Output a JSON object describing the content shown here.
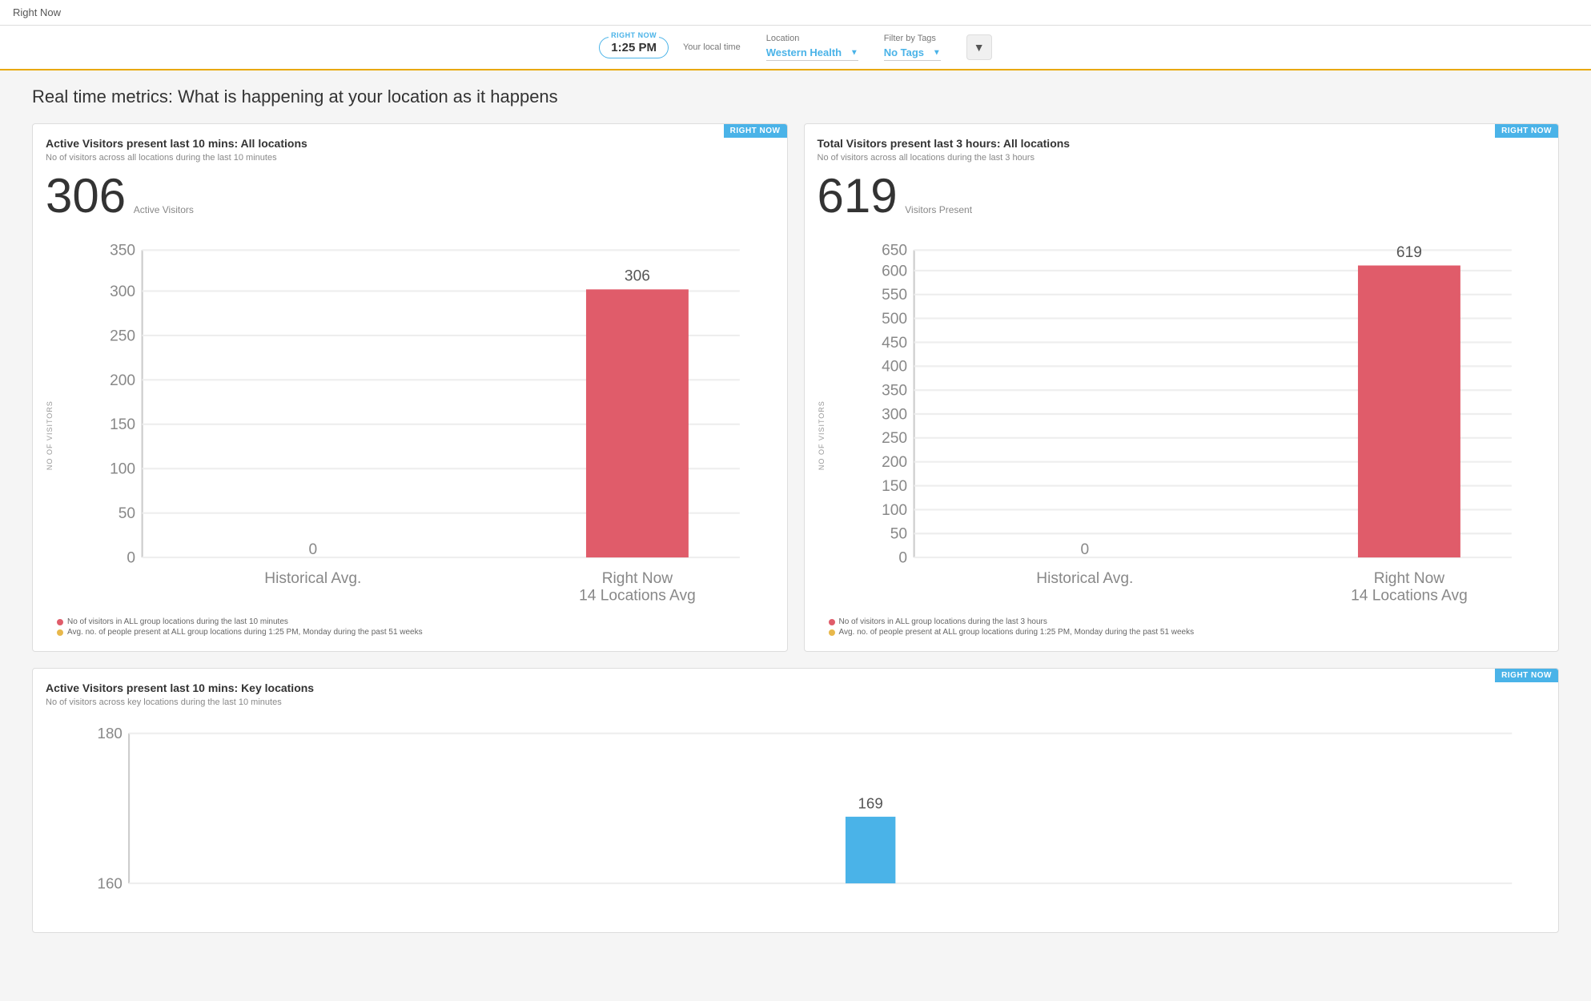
{
  "topBar": {
    "title": "Right Now"
  },
  "controls": {
    "badge": "RIGHT NOW",
    "time": "1:25 PM",
    "timeLabel": "Your local time",
    "locationLabel": "Location",
    "locationValue": "Western Health",
    "filterLabel": "Filter by Tags",
    "filterValue": "No Tags"
  },
  "pageHeading": "Real time metrics: What is happening at your location as it happens",
  "card1": {
    "badge": "RIGHT NOW",
    "title": "Active Visitors present last 10 mins: All locations",
    "subtitle": "No of visitors across all locations during the last 10 minutes",
    "bigNumber": "306",
    "bigNumberLabel": "Active Visitors",
    "yAxisLabel": "NO OF VISITORS",
    "barValue": 306,
    "barLabel": "306",
    "xLabels": [
      "Historical Avg.",
      "Right Now\n14 Locations Avg"
    ],
    "yMax": 350,
    "yTicks": [
      0,
      50,
      100,
      150,
      200,
      250,
      300,
      350
    ],
    "legend": [
      {
        "color": "#e05c6a",
        "text": "No of visitors in ALL group locations during the last 10 minutes"
      },
      {
        "color": "#e8b84b",
        "text": "Avg. no. of people present at ALL group locations during 1:25 PM, Monday during the past 51 weeks"
      }
    ]
  },
  "card2": {
    "badge": "RIGHT NOW",
    "title": "Total Visitors present last 3 hours: All locations",
    "subtitle": "No of visitors across all locations during the last 3 hours",
    "bigNumber": "619",
    "bigNumberLabel": "Visitors Present",
    "yAxisLabel": "NO OF VISITORS",
    "barValue": 619,
    "barLabel": "619",
    "xLabels": [
      "Historical Avg.",
      "Right Now\n14 Locations Avg"
    ],
    "yMax": 650,
    "yTicks": [
      0,
      50,
      100,
      150,
      200,
      250,
      300,
      350,
      400,
      450,
      500,
      550,
      600,
      650
    ],
    "legend": [
      {
        "color": "#e05c6a",
        "text": "No of visitors in ALL group locations during the last 3 hours"
      },
      {
        "color": "#e8b84b",
        "text": "Avg. no. of people present at ALL group locations during 1:25 PM, Monday during the past 51 weeks"
      }
    ]
  },
  "card3": {
    "badge": "RIGHT NOW",
    "title": "Active Visitors present last 10 mins: Key locations",
    "subtitle": "No of visitors across key locations during the last 10 minutes",
    "barValue": 169,
    "barLabel": "169",
    "yMax": 180,
    "yTicks": [
      160,
      180
    ]
  }
}
